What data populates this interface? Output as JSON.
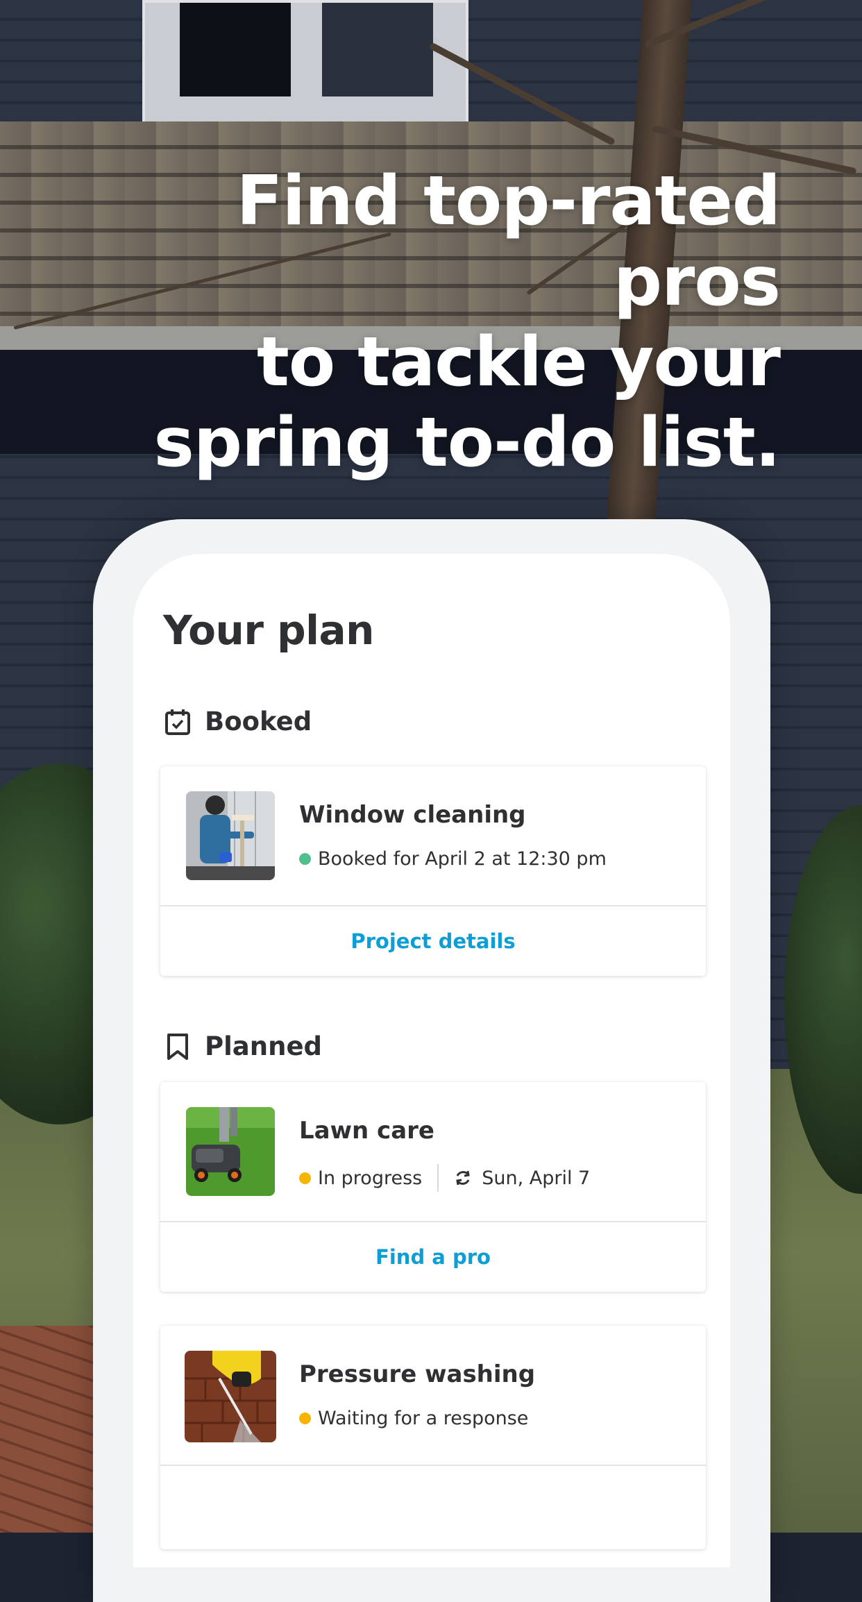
{
  "headline": {
    "line1": "Find top-rated pros",
    "line2": "to tackle your",
    "line3": "spring to-do list."
  },
  "plan": {
    "title": "Your plan",
    "sections": {
      "booked": {
        "label": "Booked",
        "icon": "calendar-check-icon",
        "card": {
          "title": "Window cleaning",
          "status": "Booked for April 2 at 12:30 pm",
          "status_color": "#4fc08d",
          "action": "Project details"
        }
      },
      "planned": {
        "label": "Planned",
        "icon": "bookmark-icon",
        "cards": [
          {
            "title": "Lawn care",
            "status": "In progress",
            "status_color": "#f7b500",
            "schedule": "Sun, April 7",
            "schedule_icon": "repeat-icon",
            "action": "Find a pro"
          },
          {
            "title": "Pressure washing",
            "status": "Waiting for a response",
            "status_color": "#f7b500"
          }
        ]
      }
    }
  },
  "colors": {
    "link": "#0e9ed6",
    "text": "#2f3033"
  }
}
